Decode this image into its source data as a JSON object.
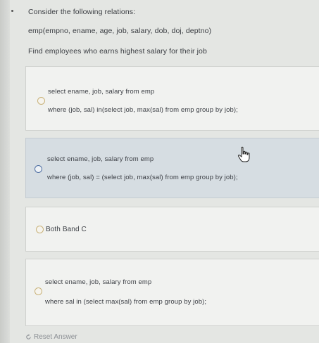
{
  "question": {
    "line1": "Consider the following relations:",
    "line2": "emp(empno, ename, age, job, salary, dob, doj, deptno)",
    "line3": "Find employees who earns highest salary for their job"
  },
  "options": [
    {
      "line1": "select ename, job, salary from emp",
      "line2": "where (job, sal) in(select job, max(sal) from emp group by job);"
    },
    {
      "line1": "select ename, job, salary from emp",
      "line2": "where (job, sal) = (select job, max(sal) from emp group by job);"
    },
    {
      "line1": "Both Band C"
    },
    {
      "line1": "select ename, job, salary from emp",
      "line2": "where sal in (select max(sal) from emp group by job);"
    }
  ],
  "reset": {
    "label": "Reset Answer",
    "icon": "reset-arrow-icon"
  },
  "colors": {
    "highlight": "#d6dde2",
    "radio_blue": "#4f6fa3",
    "radio_gold": "#c9b27a"
  }
}
